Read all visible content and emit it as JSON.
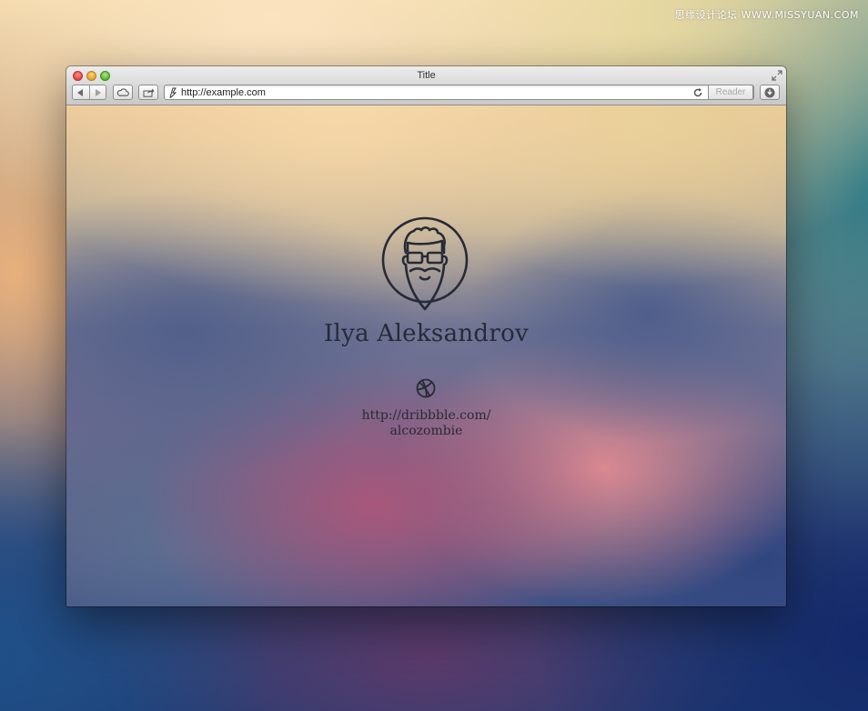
{
  "watermark": {
    "text": "思缘设计论坛 WWW.MISSYUAN.COM"
  },
  "window": {
    "title": "Title",
    "address_url": "http://example.com",
    "reader_label": "Reader"
  },
  "profile": {
    "name": "Ilya Aleksandrov",
    "link_line1": "http://dribbble.com/",
    "link_line2": "alcozombie"
  },
  "icons": {
    "avatar": "bearded-man-glasses-icon",
    "dribbble": "dribbble-icon",
    "back": "back-arrow-icon",
    "forward": "forward-arrow-icon",
    "icloud": "cloud-icon",
    "share": "share-icon",
    "reload": "reload-icon",
    "downloads": "download-icon"
  },
  "colors": {
    "profile_text": "#262b35",
    "close": "#e0443e",
    "minimize": "#e0a32a",
    "maximize": "#57b533"
  }
}
